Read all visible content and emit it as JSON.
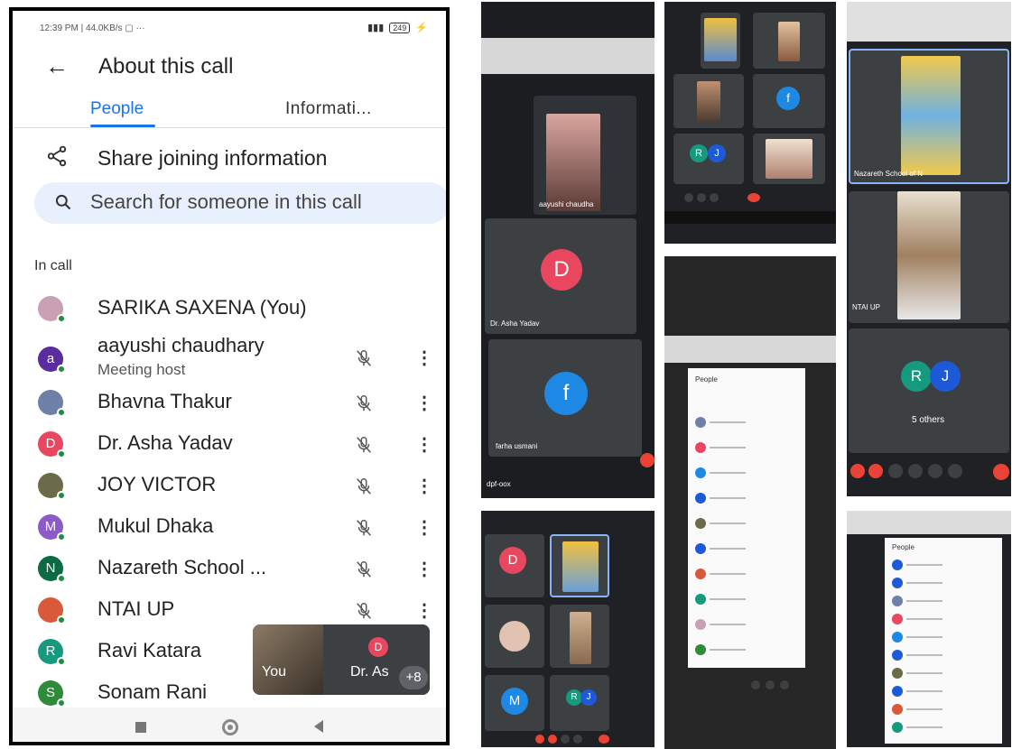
{
  "status": {
    "left": "12:39 PM | 44.0KB/s",
    "battery": "249"
  },
  "header": {
    "title": "About this call"
  },
  "tabs": {
    "people": "People",
    "information": "Informati..."
  },
  "share_label": "Share joining information",
  "search": {
    "placeholder": "Search for someone in this call"
  },
  "section_label": "In call",
  "participants": [
    {
      "name": "SARIKA SAXENA (You)",
      "initial": "",
      "color": "#c9a0b4",
      "muted": false
    },
    {
      "name": "aayushi chaudhary",
      "sub": "Meeting host",
      "initial": "a",
      "color": "#5b2c9f",
      "muted": true
    },
    {
      "name": "Bhavna Thakur",
      "initial": "",
      "color": "#6e7fa8",
      "muted": true
    },
    {
      "name": "Dr. Asha Yadav",
      "initial": "D",
      "color": "#e8475f",
      "muted": true
    },
    {
      "name": "JOY VICTOR",
      "initial": "",
      "color": "#6b6b4a",
      "muted": true
    },
    {
      "name": "Mukul Dhaka",
      "initial": "M",
      "color": "#8e59c9",
      "muted": true
    },
    {
      "name": "Nazareth School ...",
      "initial": "N",
      "color": "#0b6b45",
      "muted": true
    },
    {
      "name": "NTAI UP",
      "initial": "",
      "color": "#d85a3a",
      "muted": true
    },
    {
      "name": "Ravi Katara",
      "initial": "R",
      "color": "#159a7e",
      "muted": false
    },
    {
      "name": "Sonam Rani",
      "initial": "S",
      "color": "#2e8b3a",
      "muted": false
    }
  ],
  "tiles": {
    "you": "You",
    "other": "Dr. As",
    "other_initial": "D",
    "more": "+8"
  },
  "collage": {
    "p1": {
      "label_top": "aayushi chaudha",
      "d_initial": "D",
      "d_label": "Dr. Asha Yadav",
      "f_initial": "f",
      "f_label": "farha usmani",
      "corner": "dpf-oox"
    },
    "p2": {
      "r_initial": "R",
      "j_initial": "J",
      "f_initial": "f"
    },
    "p3": {
      "label_top": "Nazareth School of N",
      "mid_label": "NTAI UP",
      "r_initial": "R",
      "j_initial": "J",
      "others": "5 others"
    },
    "p4": {
      "title": "People"
    },
    "p5": {
      "d_initial": "D",
      "m_initial": "M",
      "r_initial": "R",
      "j_initial": "J"
    },
    "p6": {
      "title": "People"
    }
  }
}
